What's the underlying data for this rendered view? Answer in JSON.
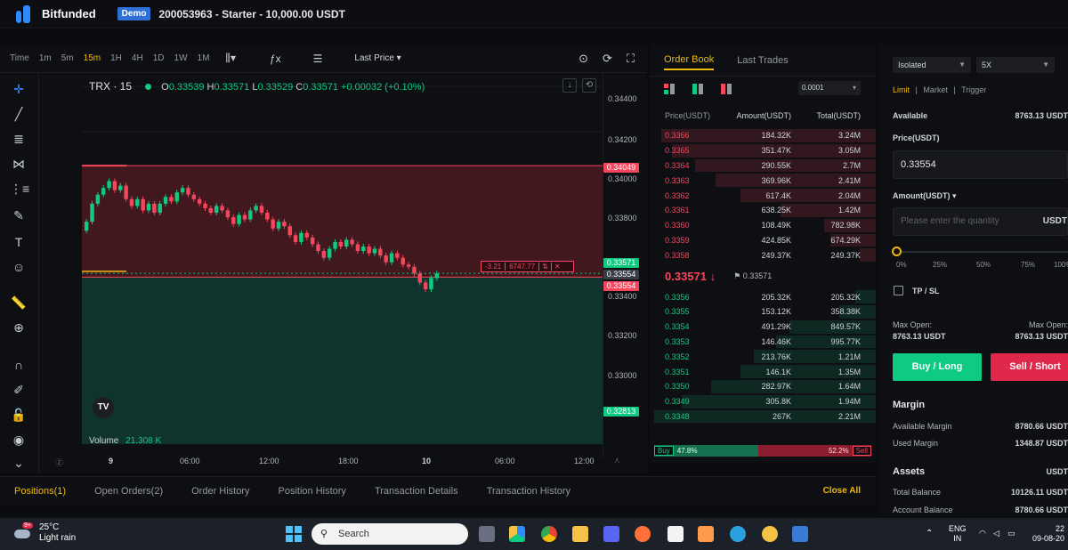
{
  "header": {
    "brand": "Bitfunded",
    "badge": "Demo",
    "account": "200053963 - Starter - 10,000.00 USDT"
  },
  "chart_toolbar": {
    "time_label": "Time",
    "timeframes": [
      "1m",
      "5m",
      "15m",
      "1H",
      "4H",
      "1D",
      "1W",
      "1M"
    ],
    "active_timeframe": "15m",
    "price_type": "Last Price"
  },
  "chart": {
    "symbol": "TRX · 15",
    "ohlc": {
      "o_label": "O",
      "o": "0.33539",
      "h_label": "H",
      "h": "0.33571",
      "l_label": "L",
      "l": "0.33529",
      "c_label": "C",
      "c": "0.33571",
      "change": "+0.00032 (+0.10%)"
    },
    "volume_label": "Volume",
    "volume_value": "21.308 K",
    "price_ticks": [
      "0.34400",
      "0.34200",
      "0.34000",
      "0.33800",
      "0.33400",
      "0.33200",
      "0.33000"
    ],
    "badges": {
      "tp": "0.34049",
      "last": "0.33571",
      "entry": "0.33554",
      "mark": "0.33554",
      "sl": "0.32813"
    },
    "position_line": {
      "pnl": "-3.21",
      "qty": "6747.77"
    },
    "time_ticks": [
      "9",
      "06:00",
      "12:00",
      "18:00",
      "10",
      "06:00",
      "12:00"
    ],
    "colors": {
      "up": "#0ecb81",
      "down": "#f6465d",
      "tp_zone": "#4a1a20",
      "sl_zone": "#0f3a32"
    }
  },
  "chart_data": {
    "type": "candlestick",
    "title": "TRX · 15",
    "xlabel": "",
    "ylabel": "",
    "ylim": [
      0.3275,
      0.3446
    ],
    "x_ticks": [
      "9",
      "06:00",
      "12:00",
      "18:00",
      "10",
      "06:00",
      "12:00"
    ],
    "series": [
      {
        "close": [
          0.338,
          0.3388,
          0.3392,
          0.3395,
          0.3398,
          0.3394,
          0.3396,
          0.339,
          0.3387,
          0.339,
          0.3385,
          0.3388,
          0.3384,
          0.3388,
          0.3391,
          0.3389,
          0.3393,
          0.3395,
          0.3392,
          0.339,
          0.3388,
          0.3386,
          0.3384,
          0.3387,
          0.3385,
          0.3382,
          0.3379,
          0.3383,
          0.3381,
          0.3385,
          0.3387,
          0.3384,
          0.3381,
          0.3377,
          0.338,
          0.3378,
          0.3374,
          0.3371,
          0.3375,
          0.3373,
          0.337,
          0.3367,
          0.3364,
          0.3368,
          0.3371,
          0.3369,
          0.3372,
          0.337,
          0.3367,
          0.3369,
          0.3366,
          0.3368,
          0.3365,
          0.3362,
          0.3366,
          0.3364,
          0.3361,
          0.336,
          0.3357,
          0.3353,
          0.335,
          0.3355,
          0.3357
        ]
      }
    ],
    "tp_price": 0.34049,
    "sl_price": 0.32813,
    "entry_price": 0.33554,
    "last_price": 0.33571
  },
  "orderbook": {
    "tabs": [
      "Order Book",
      "Last Trades"
    ],
    "step": "0.0001",
    "headers": [
      "Price(USDT)",
      "Amount(USDT)",
      "Total(USDT)"
    ],
    "asks": [
      {
        "price": "0.3366",
        "amount": "184.32K",
        "total": "3.24M",
        "depth": 0.95
      },
      {
        "price": "0.3365",
        "amount": "351.47K",
        "total": "3.05M",
        "depth": 0.9
      },
      {
        "price": "0.3364",
        "amount": "290.55K",
        "total": "2.7M",
        "depth": 0.8
      },
      {
        "price": "0.3363",
        "amount": "369.96K",
        "total": "2.41M",
        "depth": 0.71
      },
      {
        "price": "0.3362",
        "amount": "617.4K",
        "total": "2.04M",
        "depth": 0.6
      },
      {
        "price": "0.3361",
        "amount": "638.25K",
        "total": "1.42M",
        "depth": 0.42
      },
      {
        "price": "0.3360",
        "amount": "108.49K",
        "total": "782.98K",
        "depth": 0.23
      },
      {
        "price": "0.3359",
        "amount": "424.85K",
        "total": "674.29K",
        "depth": 0.2
      },
      {
        "price": "0.3358",
        "amount": "249.37K",
        "total": "249.37K",
        "depth": 0.07
      }
    ],
    "mid_price": "0.33571 ↓",
    "mark_price": "0.33571",
    "bids": [
      {
        "price": "0.3356",
        "amount": "205.32K",
        "total": "205.32K",
        "depth": 0.09
      },
      {
        "price": "0.3355",
        "amount": "153.12K",
        "total": "358.38K",
        "depth": 0.16
      },
      {
        "price": "0.3354",
        "amount": "491.29K",
        "total": "849.57K",
        "depth": 0.38
      },
      {
        "price": "0.3353",
        "amount": "146.46K",
        "total": "995.77K",
        "depth": 0.44
      },
      {
        "price": "0.3352",
        "amount": "213.76K",
        "total": "1.21M",
        "depth": 0.54
      },
      {
        "price": "0.3351",
        "amount": "146.1K",
        "total": "1.35M",
        "depth": 0.6
      },
      {
        "price": "0.3350",
        "amount": "282.97K",
        "total": "1.64M",
        "depth": 0.73
      },
      {
        "price": "0.3349",
        "amount": "305.8K",
        "total": "1.94M",
        "depth": 0.86
      },
      {
        "price": "0.3348",
        "amount": "267K",
        "total": "2.21M",
        "depth": 0.98
      }
    ],
    "buy_label": "Buy",
    "buy_pct": "47.8%",
    "sell_pct": "52.2%",
    "sell_label": "Sell",
    "buy_fraction": 0.478
  },
  "trade": {
    "margin_mode": "Isolated",
    "leverage": "5X",
    "order_types": [
      "Limit",
      "Market",
      "Trigger"
    ],
    "available_label": "Available",
    "available_value": "8763.13 USDT",
    "price_label": "Price(USDT)",
    "price_value": "0.33554",
    "amount_label": "Amount(USDT) ▾",
    "amount_placeholder": "Please enter the quantity",
    "amount_unit": "USDT",
    "slider_ticks": [
      "0%",
      "25%",
      "50%",
      "75%",
      "100%"
    ],
    "slider_fraction": 0,
    "tpsl_label": "TP / SL",
    "max_open_label": "Max Open:",
    "max_open_value": "8763.13 USDT",
    "max_open_label_r": "Max Open:",
    "max_open_value_r": "8763.13 USDT",
    "buy_button": "Buy / Long",
    "sell_button": "Sell / Short",
    "margin_title": "Margin",
    "available_margin_label": "Available Margin",
    "available_margin_value": "8780.66 USDT",
    "used_margin_label": "Used Margin",
    "used_margin_value": "1348.87 USDT",
    "assets_title": "Assets",
    "assets_unit": "USDT",
    "total_balance_label": "Total Balance",
    "total_balance_value": "10126.11 USDT",
    "account_balance_label": "Account Balance",
    "account_balance_value": "8780.66 USDT"
  },
  "positions": {
    "tabs": [
      "Positions(1)",
      "Open Orders(2)",
      "Order History",
      "Position History",
      "Transaction Details",
      "Transaction History"
    ],
    "close_all": "Close All"
  },
  "taskbar": {
    "weather_badge": "9+",
    "temperature": "25°C",
    "condition": "Light rain",
    "search_placeholder": "Search",
    "lang_1": "ENG",
    "lang_2": "IN",
    "time": "22",
    "date": "09-08-20"
  }
}
